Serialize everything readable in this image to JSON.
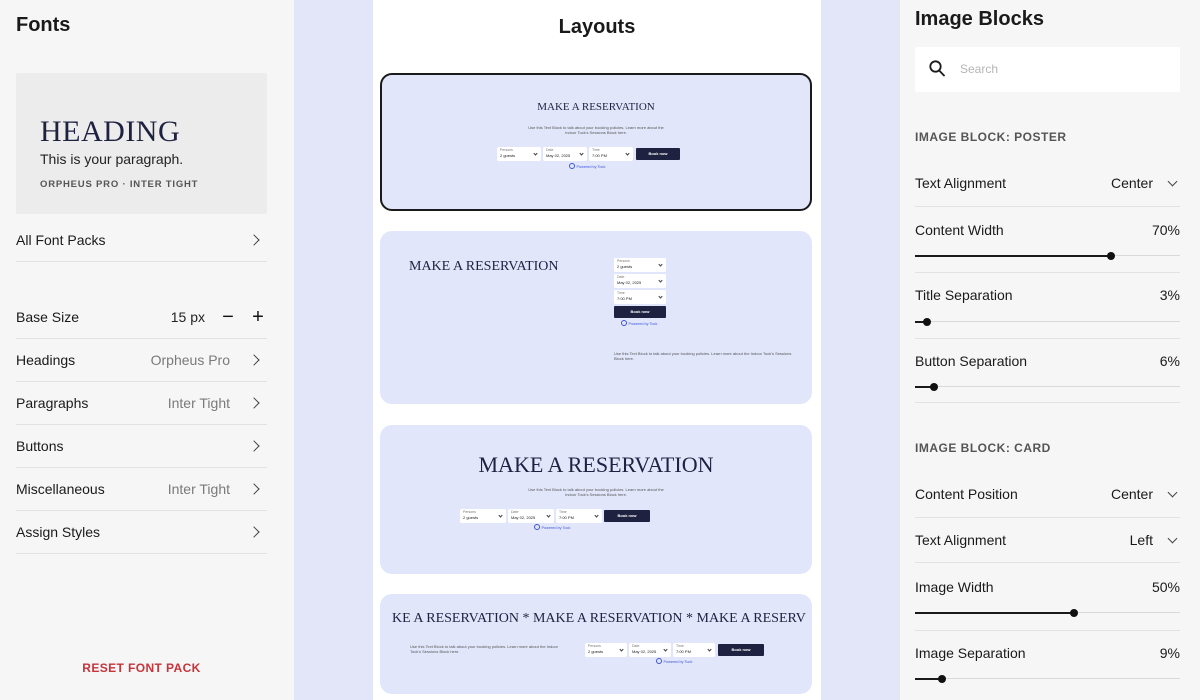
{
  "fonts_panel": {
    "title": "Fonts",
    "preview": {
      "heading": "HEADING",
      "paragraph": "This is your paragraph.",
      "font_pair": "ORPHEUS PRO · INTER TIGHT"
    },
    "all_font_packs": "All Font Packs",
    "base_size": {
      "label": "Base Size",
      "value": "15 px",
      "minus": "−",
      "plus": "+"
    },
    "rows": [
      {
        "label": "Headings",
        "value": "Orpheus Pro"
      },
      {
        "label": "Paragraphs",
        "value": "Inter Tight"
      },
      {
        "label": "Buttons",
        "value": ""
      },
      {
        "label": "Miscellaneous",
        "value": "Inter Tight"
      },
      {
        "label": "Assign Styles",
        "value": ""
      }
    ],
    "reset": "RESET FONT PACK"
  },
  "layouts_panel": {
    "title": "Layouts",
    "reservation_title": "MAKE A RESERVATION",
    "marquee_text": "KE A RESERVATION  *  MAKE A RESERVATION  *  MAKE A RESERV",
    "body_text": "Use this Text Block to talk about your booking policies. Learn more about the Indoor Tock's Sessions Block here.",
    "fields": {
      "persons_label": "Persons",
      "persons_value": "2 guests",
      "date_label": "Date",
      "date_value": "May 02, 2025",
      "time_label": "Time",
      "time_value": "7:00 PM"
    },
    "book_now": "Book now",
    "powered_by": "Powered by Tock"
  },
  "image_blocks_panel": {
    "title": "Image Blocks",
    "search_placeholder": "Search",
    "poster": {
      "heading": "IMAGE BLOCK: POSTER",
      "text_alignment": {
        "label": "Text Alignment",
        "value": "Center"
      },
      "content_width": {
        "label": "Content Width",
        "value": "70%",
        "fraction": 0.74
      },
      "title_separation": {
        "label": "Title Separation",
        "value": "3%",
        "fraction": 0.045
      },
      "button_separation": {
        "label": "Button Separation",
        "value": "6%",
        "fraction": 0.07
      }
    },
    "card": {
      "heading": "IMAGE BLOCK: CARD",
      "content_position": {
        "label": "Content Position",
        "value": "Center"
      },
      "text_alignment": {
        "label": "Text Alignment",
        "value": "Left"
      },
      "image_width": {
        "label": "Image Width",
        "value": "50%",
        "fraction": 0.6
      },
      "image_separation": {
        "label": "Image Separation",
        "value": "9%",
        "fraction": 0.1
      }
    }
  }
}
